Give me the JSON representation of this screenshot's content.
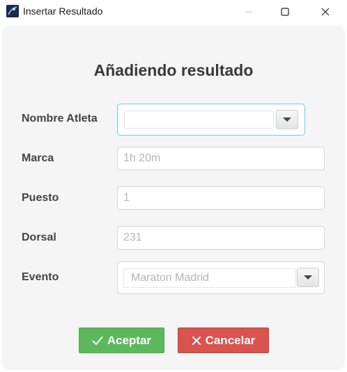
{
  "window": {
    "title": "Insertar Resultado",
    "controls": {
      "minimize_icon": "minimize-icon",
      "maximize_icon": "maximize-icon",
      "close_icon": "close-icon"
    }
  },
  "form": {
    "heading": "Añadiendo resultado",
    "fields": {
      "athlete": {
        "label": "Nombre Atleta",
        "value": ""
      },
      "mark": {
        "label": "Marca",
        "placeholder": "1h 20m"
      },
      "position": {
        "label": "Puesto",
        "placeholder": "1"
      },
      "bib": {
        "label": "Dorsal",
        "placeholder": "231"
      },
      "event": {
        "label": "Evento",
        "value": "Maraton Madrid"
      }
    },
    "buttons": {
      "accept": {
        "label": "Aceptar",
        "icon": "check-icon",
        "color": "#5cb85c"
      },
      "cancel": {
        "label": "Cancelar",
        "icon": "x-icon",
        "color": "#d9534f"
      }
    }
  },
  "colors": {
    "focus_border": "#6fcbdc",
    "panel_bg": "#f5f5f5",
    "heading": "#3a3a3a"
  }
}
